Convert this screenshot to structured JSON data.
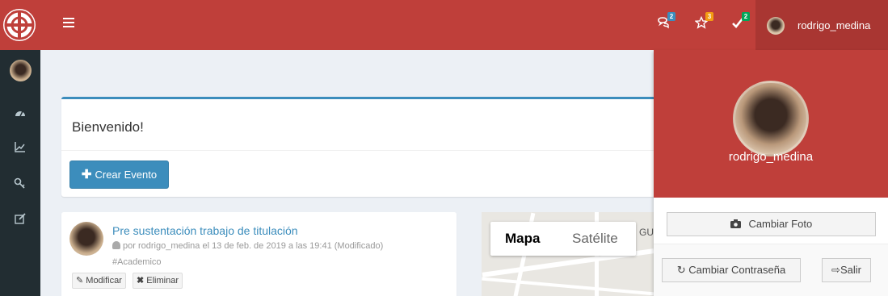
{
  "header": {
    "notifications": [
      {
        "icon": "comments-icon",
        "badge": "2",
        "badge_color": "#3c8dbc"
      },
      {
        "icon": "star-icon",
        "badge": "3",
        "badge_color": "#f39c12"
      },
      {
        "icon": "check-icon",
        "badge": "2",
        "badge_color": "#00a65a"
      }
    ],
    "username": "rodrigo_medina"
  },
  "sidebar": {
    "icons": [
      "dashboard-icon",
      "chart-icon",
      "key-icon",
      "edit-icon"
    ]
  },
  "welcome": {
    "title": "Bienvenido!",
    "create_button": "Crear Evento"
  },
  "event": {
    "title": "Pre sustentación trabajo de titulación",
    "meta": "por rodrigo_medina el 13 de feb. de 2019 a las 19:41 (Modificado)",
    "tag": "#Academico",
    "edit_label": "Modificar",
    "delete_label": "Eliminar"
  },
  "map": {
    "option_map": "Mapa",
    "option_satellite": "Satélite",
    "edge_letters": "GU"
  },
  "user_panel": {
    "username": "rodrigo_medina",
    "change_photo": "Cambiar Foto",
    "change_password": "Cambiar Contraseña",
    "logout": "Salir"
  },
  "colors": {
    "header": "#bf3f3a",
    "sidebar": "#222d32",
    "primary": "#3c8dbc"
  }
}
